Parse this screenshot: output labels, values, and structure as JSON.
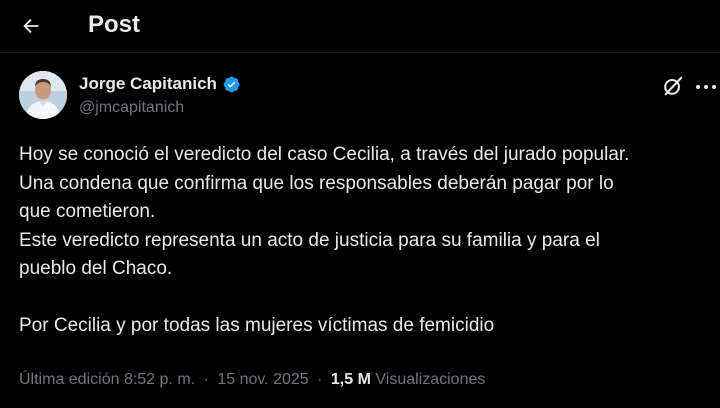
{
  "header": {
    "title": "Post",
    "back_icon": "arrow-left-icon"
  },
  "author": {
    "name": "Jorge Capitanich",
    "handle": "@jmcapitanich",
    "verified": true,
    "verified_color": "#1d9bf0",
    "avatar_icon": "profile-photo"
  },
  "actions": {
    "grok_icon": "grok-icon",
    "more_icon": "more-horizontal-icon"
  },
  "post": {
    "paragraph1_line1": "Hoy se conoció el veredicto del caso Cecilia, a través del jurado popular.",
    "paragraph1_line2": "Una condena que confirma que los responsables deberán pagar por lo",
    "paragraph1_line3": "que cometieron.",
    "paragraph2_line1": "Este veredicto representa un acto de justicia para su familia y para el",
    "paragraph2_line2": "pueblo del Chaco.",
    "paragraph3": "Por Cecilia y por todas las mujeres víctimas de femicidio"
  },
  "meta": {
    "edited_label": "Última edición",
    "time": "8:52 p. m.",
    "separator": "·",
    "date": "15 nov. 2025",
    "views_count": "1,5 M",
    "views_label": "Visualizaciones"
  },
  "colors": {
    "background": "#000000",
    "text": "#e7e9ea",
    "secondary": "#71767b",
    "accent": "#1d9bf0"
  }
}
